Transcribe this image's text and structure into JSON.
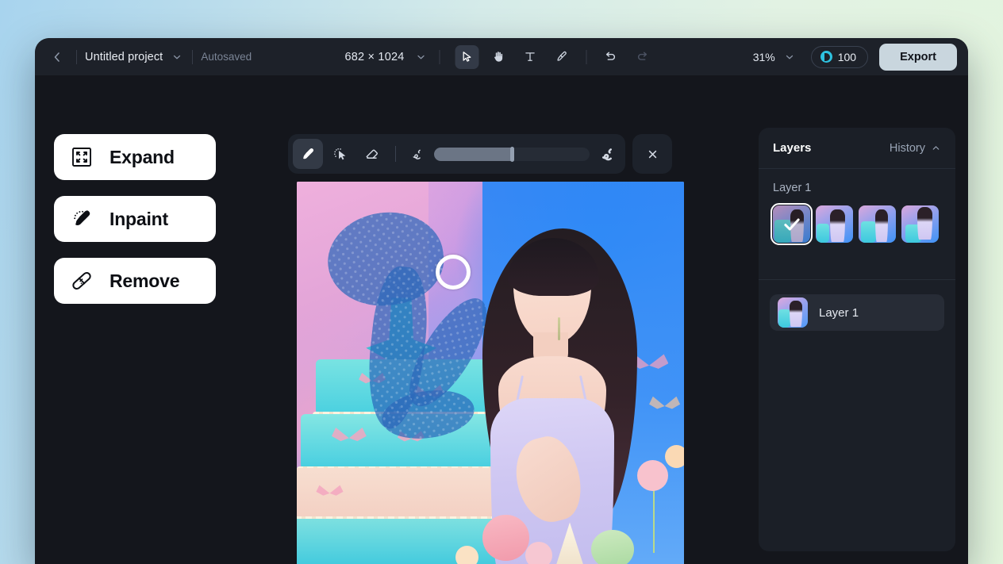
{
  "header": {
    "back_icon": "chevron-left-icon",
    "project_name": "Untitled project",
    "project_dropdown_icon": "chevron-down-icon",
    "autosaved_label": "Autosaved",
    "canvas_dimensions": "682 × 1024",
    "dimensions_dropdown_icon": "chevron-down-icon",
    "tools": [
      {
        "name": "select-tool",
        "icon": "cursor-arrow-icon",
        "active": true,
        "disabled": false
      },
      {
        "name": "hand-tool",
        "icon": "hand-icon",
        "active": false,
        "disabled": false
      },
      {
        "name": "text-tool",
        "icon": "text-t-icon",
        "active": false,
        "disabled": false
      },
      {
        "name": "brush-tool",
        "icon": "paintbrush-icon",
        "active": false,
        "disabled": false
      },
      {
        "name": "undo",
        "icon": "undo-arrow-icon",
        "active": false,
        "disabled": false
      },
      {
        "name": "redo",
        "icon": "redo-arrow-icon",
        "active": false,
        "disabled": true
      }
    ],
    "zoom_level": "31%",
    "zoom_dropdown_icon": "chevron-down-icon",
    "credits_icon": "credit-coin-icon",
    "credits_value": "100",
    "export_label": "Export"
  },
  "left_actions": [
    {
      "label": "Expand",
      "icon": "expand-frame-icon"
    },
    {
      "label": "Inpaint",
      "icon": "inpaint-brush-icon"
    },
    {
      "label": "Remove",
      "icon": "bandage-icon"
    }
  ],
  "brush_toolbar": {
    "tools": [
      {
        "name": "brush-tool",
        "icon": "paintbrush-icon",
        "active": true
      },
      {
        "name": "magic-select-tool",
        "icon": "magic-cursor-icon",
        "active": false
      },
      {
        "name": "eraser-tool",
        "icon": "eraser-icon",
        "active": false
      }
    ],
    "size_small_icon": "small-stroke-icon",
    "size_large_icon": "large-stroke-icon",
    "brush_size_percent": 50,
    "close_icon": "close-x-icon"
  },
  "canvas": {
    "brush_cursor_icon": "brush-cursor-ring",
    "mask_color": "#2c68ba"
  },
  "layers_panel": {
    "tab_layers": "Layers",
    "tab_history": "History",
    "history_chevron_icon": "chevron-up-icon",
    "layer_group_title": "Layer 1",
    "variants": [
      {
        "name": "variant-1",
        "selected": true,
        "check_icon": "check-icon"
      },
      {
        "name": "variant-2",
        "selected": false
      },
      {
        "name": "variant-3",
        "selected": false
      },
      {
        "name": "variant-4",
        "selected": false
      }
    ],
    "layer_rows": [
      {
        "name": "Layer 1"
      }
    ]
  },
  "colors": {
    "window_bg": "#14161c",
    "header_bg": "#1d2129",
    "panel_bg": "#1b1f27",
    "accent_cyan": "#2ec2e0",
    "export_bg": "#c9d6de"
  }
}
